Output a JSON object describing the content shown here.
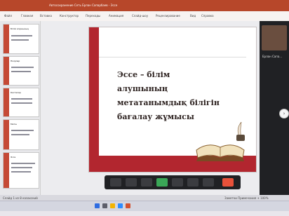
{
  "titlebar": {
    "text": "Автосохранение  Сеть  Ерлан Сапарбаев - Эссе"
  },
  "ribbon": {
    "items": [
      "Файл",
      "Главная",
      "Вставка",
      "Конструктор",
      "Переходы",
      "Анимация",
      "Слайд-шоу",
      "Рецензирование",
      "Вид",
      "Справка"
    ]
  },
  "slide": {
    "title_lines": [
      "Эссе – білім алушының",
      "метатанымдық білігін",
      "бағалау жұмысы"
    ]
  },
  "thumbnails": [
    {
      "label": "Білім алушының"
    },
    {
      "label": "Пікірлер"
    },
    {
      "label": "Кестелер"
    },
    {
      "label": "Мәтін"
    },
    {
      "label": "Эссе"
    }
  ],
  "zoom": {
    "name": "Ерлан Сапа..."
  },
  "statusbar": {
    "left": "Слайд 1 из 8  казахский",
    "right": "Заметки  Примечания  + 100%"
  },
  "icons": {
    "next": "chevron-right-icon",
    "toolbar": [
      "microphone-icon",
      "video-icon",
      "participants-icon",
      "share-screen-icon",
      "chat-icon",
      "record-icon",
      "reactions-icon",
      "end-call-icon"
    ]
  },
  "colors": {
    "accent_red": "#b2262f",
    "ribbon_brand": "#b7472a"
  }
}
